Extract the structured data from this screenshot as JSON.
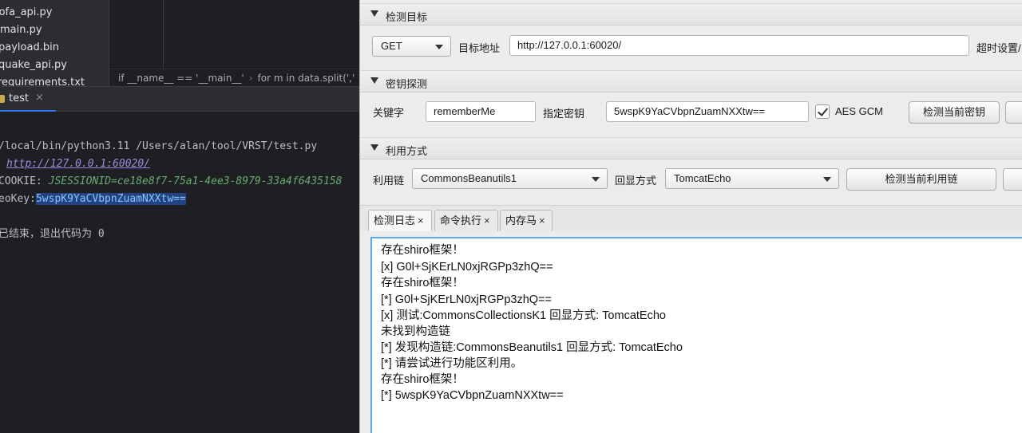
{
  "ide": {
    "files": [
      "fofa_api.py",
      "main.py",
      "payload.bin",
      "quake_api.py",
      "requirements.txt"
    ],
    "breadcrumbs": [
      "if __name__ == '__main__'",
      "for m in data.split(','"
    ],
    "run_tab": {
      "label": "test",
      "close": "×"
    },
    "console": {
      "line1": "/local/bin/python3.11 /Users/alan/tool/VRST/test.py",
      "line2_url": "http://127.0.0.1:60020/",
      "line3_prefix": "COOKIE: ",
      "line3_value": "JSESSIONID=ce18e8f7-75a1-4ee3-8979-33a4f6435158",
      "line4_prefix": "eoKey:",
      "line4_value": "5wspK9YaCVbpnZuamNXXtw==",
      "line5": "已结束，退出代码为 0"
    }
  },
  "tool": {
    "target": {
      "title": "检测目标",
      "method": "GET",
      "url_label": "目标地址",
      "url_value": "http://127.0.0.1:60020/",
      "timeout_label": "超时设置/"
    },
    "key_probe": {
      "title": "密钥探测",
      "keyword_label": "关键字",
      "keyword_value": "rememberMe",
      "key_label": "指定密钥",
      "key_value": "5wspK9YaCVbpnZuamNXXtw==",
      "aes_gcm_label": "AES GCM",
      "aes_gcm_checked": true,
      "check_key_button": "检测当前密钥"
    },
    "exploit": {
      "title": "利用方式",
      "chain_label": "利用链",
      "chain_value": "CommonsBeanutils1",
      "echo_label": "回显方式",
      "echo_value": "TomcatEcho",
      "check_chain_button": "检测当前利用链"
    },
    "tabs": [
      {
        "label": "检测日志",
        "close": "×"
      },
      {
        "label": "命令执行",
        "close": "×"
      },
      {
        "label": "内存马",
        "close": "×"
      }
    ],
    "log": [
      "存在shiro框架！",
      "[x] G0l+SjKErLN0xjRGPp3zhQ==",
      "存在shiro框架！",
      "[*] G0l+SjKErLN0xjRGPp3zhQ==",
      "[x] 测试:CommonsCollectionsK1  回显方式: TomcatEcho",
      "未找到构造链",
      "[*] 发现构造链:CommonsBeanutils1  回显方式: TomcatEcho",
      "[*] 请尝试进行功能区利用。",
      "存在shiro框架！",
      "[*] 5wspK9YaCVbpnZuamNXXtw=="
    ]
  }
}
